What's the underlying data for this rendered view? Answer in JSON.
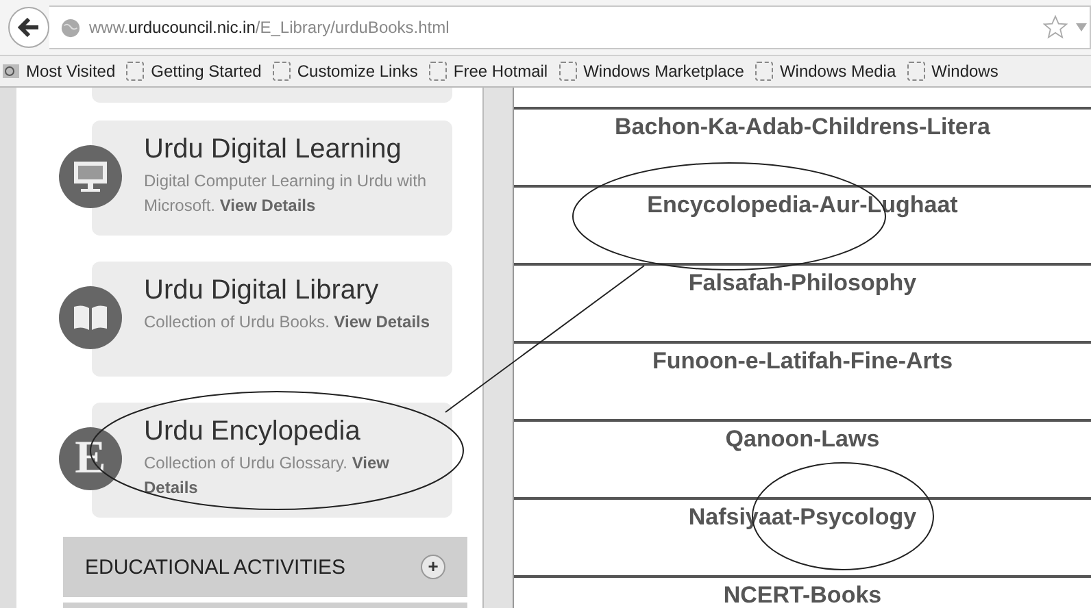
{
  "address_bar": {
    "url": "www.**urducouncil.nic.in**/E_Library/urduBooks.html"
  },
  "bookmarks": [
    {
      "label": "Most Visited",
      "kind": "search"
    },
    {
      "label": "Getting Started",
      "kind": "page"
    },
    {
      "label": "Customize Links",
      "kind": "page"
    },
    {
      "label": "Free Hotmail",
      "kind": "page"
    },
    {
      "label": "Windows Marketplace",
      "kind": "page"
    },
    {
      "label": "Windows Media",
      "kind": "page"
    },
    {
      "label": "Windows",
      "kind": "page"
    }
  ],
  "sidebar": {
    "cards": [
      {
        "title": "Urdu Digital Learning",
        "description": "Digital Computer Learning in Urdu with Microsoft. **View Details**",
        "kind": "monitor"
      },
      {
        "title": "Urdu Digital Library",
        "description": "Collection of Urdu Books. **View Details**",
        "kind": "book"
      },
      {
        "title": "Urdu Encylopedia",
        "description": "Collection of Urdu Glossary. **View Details**",
        "kind": "letter",
        "icon_letter": "E"
      }
    ],
    "sections": [
      {
        "label": "EDUCATIONAL ACTIVITIES",
        "expanded": false,
        "toggle": "+"
      }
    ]
  },
  "book_categories": [
    "Bachon-Ka-Adab-Childrens-Litera",
    "Encycolopedia-Aur-Lughaat",
    "Falsafah-Philosophy",
    "Funoon-e-Latifah-Fine-Arts",
    "Qanoon-Laws",
    "Nafsiyaat-Psycology",
    "NCERT-Books"
  ]
}
